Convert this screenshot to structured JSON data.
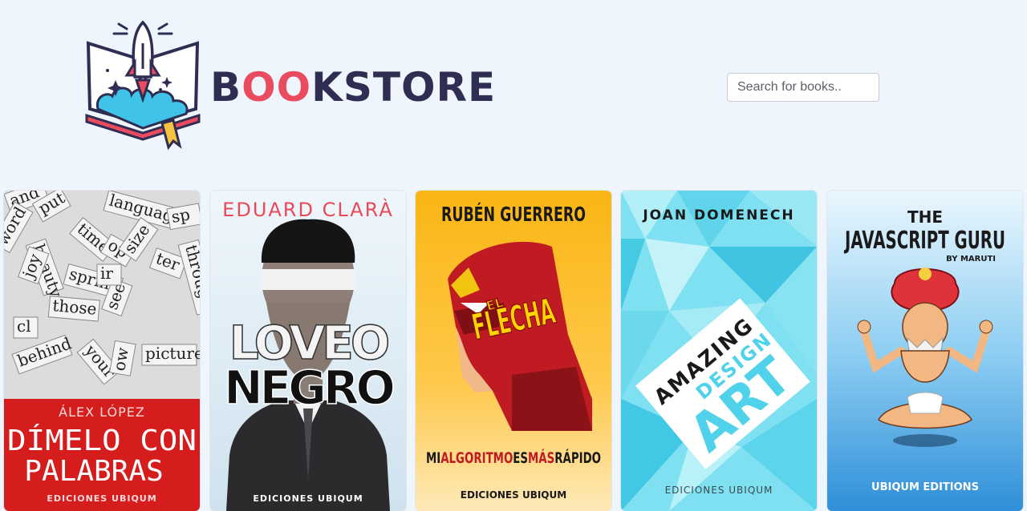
{
  "brand": {
    "name": "BOOKSTORE",
    "prefix": "B",
    "o1": "O",
    "o2": "O",
    "suffix": "KSTORE",
    "accent": "#ea4c5f",
    "ink": "#2f2d52"
  },
  "search": {
    "placeholder": "Search for books..",
    "value": ""
  },
  "books": [
    {
      "author": "ÁLEX LÓPEZ",
      "title_line1": "DÍMELO CON",
      "title_line2": "PALABRAS",
      "publisher": "EDICIONES UBIQUM",
      "words": [
        "and",
        "language",
        "put",
        "time",
        "op",
        "size",
        "beauty",
        "sp",
        "spring",
        "ter",
        "through",
        "joy",
        "those",
        "see",
        "behind",
        "picture",
        "your",
        "ow",
        "word",
        "ir",
        "cl"
      ]
    },
    {
      "author": "EDUARD CLARÀ",
      "title_line1": "LOVEO",
      "title_line2": "NEGRO",
      "publisher": "EDICIONES UBIQUM"
    },
    {
      "author": "RUBÉN GUERRERO",
      "hero_small": "EL",
      "hero_title": "FLECHA",
      "t1": "MI",
      "t2": "ALGORITMO",
      "t3": "ES",
      "t4": "MÁS",
      "t5": "RÁPIDO",
      "publisher": "EDICIONES UBIQUM"
    },
    {
      "author": "JOAN DOMENECH",
      "w1": "AMAZING",
      "w2": "DESIGN",
      "w3": "ART",
      "publisher": "EDICIONES UBIQUM"
    },
    {
      "t1": "THE",
      "t2": "JAVASCRIPT GURU",
      "byline": "BY MARUTI",
      "publisher": "UBIQUM EDITIONS"
    }
  ]
}
